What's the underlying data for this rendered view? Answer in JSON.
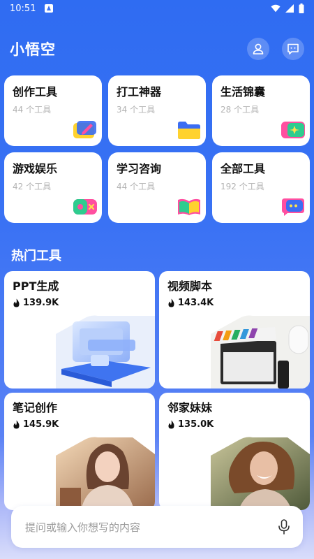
{
  "status_bar": {
    "time": "10:51"
  },
  "header": {
    "title": "小悟空"
  },
  "categories": [
    {
      "name": "创作工具",
      "count": "44 个工具"
    },
    {
      "name": "打工神器",
      "count": "34 个工具"
    },
    {
      "name": "生活锦囊",
      "count": "28 个工具"
    },
    {
      "name": "游戏娱乐",
      "count": "42 个工具"
    },
    {
      "name": "学习咨询",
      "count": "44 个工具"
    },
    {
      "name": "全部工具",
      "count": "192 个工具"
    }
  ],
  "hot_section": {
    "title": "热门工具"
  },
  "hot_tools": [
    {
      "name": "PPT生成",
      "stat": "139.9K"
    },
    {
      "name": "视频脚本",
      "stat": "143.4K"
    },
    {
      "name": "笔记创作",
      "stat": "145.9K"
    },
    {
      "name": "邻家妹妹",
      "stat": "135.0K"
    }
  ],
  "input": {
    "placeholder": "提问或输入你想写的内容"
  },
  "colors": {
    "primary": "#2f6cf2",
    "card": "#ffffff",
    "muted_text": "#b3b3b3"
  }
}
